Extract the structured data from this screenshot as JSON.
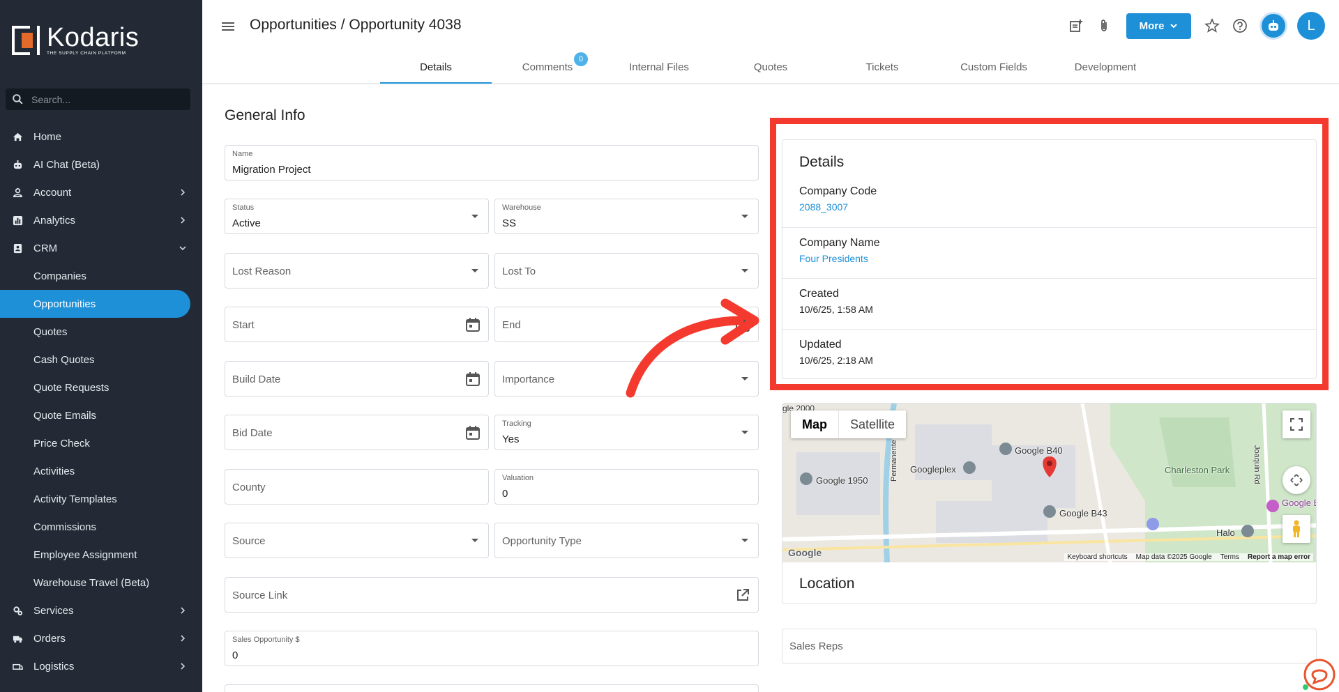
{
  "app": {
    "brand": "Kodaris",
    "tagline": "THE SUPPLY CHAIN PLATFORM",
    "search_placeholder": "Search..."
  },
  "sidebar": {
    "items": [
      {
        "label": "Home",
        "icon": "home-icon"
      },
      {
        "label": "AI Chat (Beta)",
        "icon": "robot-icon"
      },
      {
        "label": "Account",
        "icon": "person-icon",
        "expandable": true
      },
      {
        "label": "Analytics",
        "icon": "analytics-icon",
        "expandable": true
      },
      {
        "label": "CRM",
        "icon": "contacts-icon",
        "expanded": true
      }
    ],
    "crm_sub": [
      "Companies",
      "Opportunities",
      "Quotes",
      "Cash Quotes",
      "Quote Requests",
      "Quote Emails",
      "Price Check",
      "Activities",
      "Activity Templates",
      "Commissions",
      "Employee Assignment",
      "Warehouse Travel (Beta)"
    ],
    "active_sub": "Opportunities",
    "bottom_items": [
      {
        "label": "Services",
        "icon": "services-icon"
      },
      {
        "label": "Orders",
        "icon": "truck-icon"
      },
      {
        "label": "Logistics",
        "icon": "logistics-icon"
      }
    ]
  },
  "header": {
    "title": "Opportunities / Opportunity 4038",
    "more_label": "More",
    "avatar_letter": "L",
    "tabs": [
      "Details",
      "Comments",
      "Internal Files",
      "Quotes",
      "Tickets",
      "Custom Fields",
      "Development"
    ],
    "active_tab": "Details",
    "comments_badge": "0"
  },
  "general": {
    "title": "General Info",
    "name_label": "Name",
    "name_value": "Migration Project",
    "status_label": "Status",
    "status_value": "Active",
    "warehouse_label": "Warehouse",
    "warehouse_value": "SS",
    "lost_reason": "Lost Reason",
    "lost_to": "Lost To",
    "start": "Start",
    "end": "End",
    "build_date": "Build Date",
    "importance": "Importance",
    "bid_date": "Bid Date",
    "tracking_label": "Tracking",
    "tracking_value": "Yes",
    "county": "County",
    "valuation_label": "Valuation",
    "valuation_value": "0",
    "source": "Source",
    "opportunity_type": "Opportunity Type",
    "source_link": "Source Link",
    "sales_opp_label": "Sales Opportunity $",
    "sales_opp_value": "0"
  },
  "details": {
    "title": "Details",
    "rows": [
      {
        "label": "Company Code",
        "value": "2088_3007",
        "link": true
      },
      {
        "label": "Company Name",
        "value": "Four Presidents",
        "link": true
      },
      {
        "label": "Created",
        "value": "10/6/25, 1:58 AM",
        "link": false
      },
      {
        "label": "Updated",
        "value": "10/6/25, 2:18 AM",
        "link": false
      }
    ]
  },
  "map": {
    "tab_map": "Map",
    "tab_satellite": "Satellite",
    "pois": [
      "Google B40",
      "Googleplex",
      "Google 1950",
      "Google B43",
      "Charleston Park",
      "Halo",
      "Google Experie",
      "Permanente Creek",
      "Joaquin Rd",
      "gle 2000"
    ],
    "footer": [
      "Keyboard shortcuts",
      "Map data ©2025 Google",
      "Terms",
      "Report a map error"
    ],
    "google_logo": "Google",
    "location_title": "Location"
  },
  "sales_reps": "Sales Reps",
  "colors": {
    "accent": "#1e90d8",
    "sidebar_bg": "#232a35",
    "highlight_red": "#f43a2f"
  }
}
